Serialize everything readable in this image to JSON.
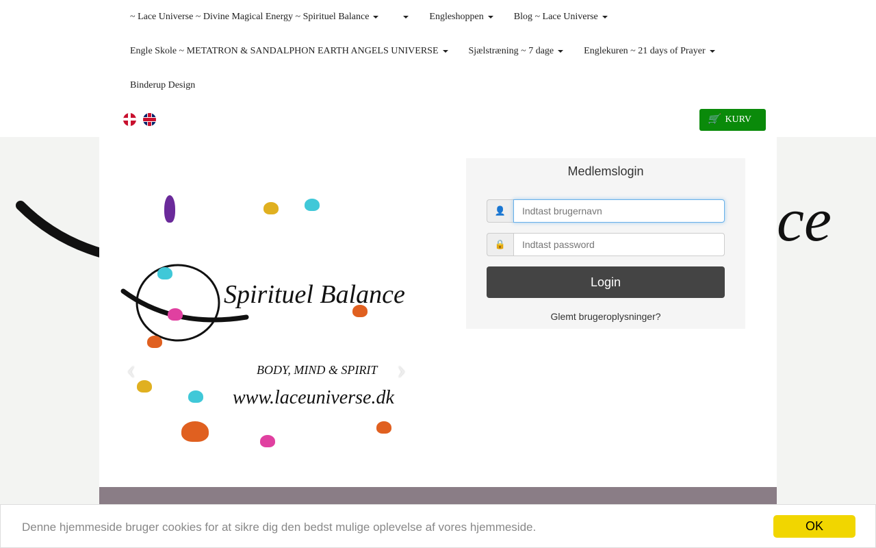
{
  "nav": {
    "row1": [
      "~ Lace Universe ~ Divine Magical Energy ~ Spirituel Balance",
      "",
      "Engleshoppen",
      "Blog ~ Lace Universe"
    ],
    "row2": [
      "Engle Skole ~ METATRON & SANDALPHON EARTH ANGELS UNIVERSE",
      "Sjælstræning ~ 7 dage",
      "Englekuren ~ 21 days of Prayer"
    ],
    "row3": [
      "Binderup Design"
    ]
  },
  "cart": {
    "label": "KURV",
    "color": "#0a8a0a"
  },
  "slider": {
    "title": "Spirituel Balance",
    "subtitle": "BODY, MIND & SPIRIT",
    "url": "www.laceuniverse.dk",
    "prev": "‹",
    "next": "›"
  },
  "login": {
    "title": "Medlemslogin",
    "username_placeholder": "Indtast brugernavn",
    "password_placeholder": "Indtast password",
    "button": "Login",
    "forgot": "Glemt brugeroplysninger?"
  },
  "cookie": {
    "text": "Denne hjemmeside bruger cookies for at sikre dig den bedst mulige oplevelse af vores hjemmeside.",
    "ok": "OK",
    "ok_color": "#f1d600"
  },
  "bg": {
    "letters": "ce"
  }
}
